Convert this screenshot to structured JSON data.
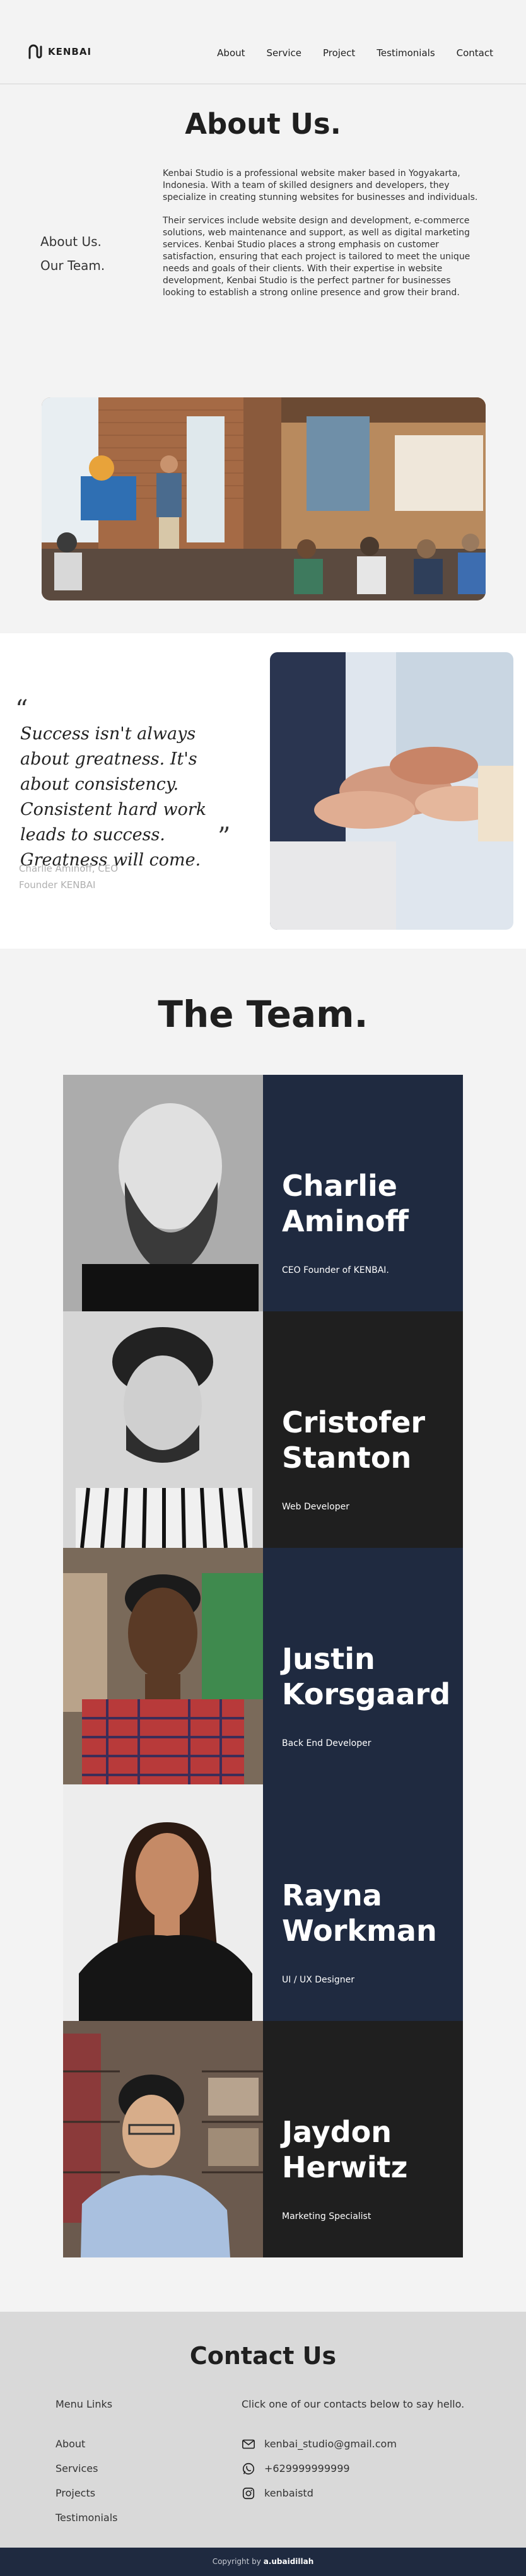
{
  "header": {
    "logo_text": "KENBAI",
    "nav": [
      "About",
      "Service",
      "Project",
      "Testimonials",
      "Contact"
    ]
  },
  "about": {
    "title": "About Us.",
    "side_links": [
      "About Us.",
      "Our Team."
    ],
    "paragraph_1": "Kenbai Studio is a professional website maker based in Yogyakarta, Indonesia. With a team of skilled designers and developers, they specialize in creating stunning websites for businesses and individuals.",
    "paragraph_2": "Their services include website design and development, e-commerce solutions, web maintenance and support, as well as digital marketing services. Kenbai Studio places a strong emphasis on customer satisfaction, ensuring that each project is tailored to meet the unique needs and goals of their clients. With their expertise in website development, Kenbai Studio is the perfect partner for businesses looking to establish a strong online presence and grow their brand."
  },
  "quote": {
    "open_mark": "“",
    "text": "Success isn't always about greatness. It's about consistency. Consistent hard work leads to success. Greatness will come.",
    "close_mark": "”",
    "author_line_1": "Charlie Aminoff, CEO",
    "author_line_2": "Founder KENBAI"
  },
  "team": {
    "title": "The Team.",
    "members": [
      {
        "name": "Charlie Aminoff",
        "role": "CEO Founder of KENBAI."
      },
      {
        "name": "Cristofer Stanton",
        "role": "Web Developer"
      },
      {
        "name": "Justin Korsgaard",
        "role": "Back End Developer"
      },
      {
        "name": "Rayna Workman",
        "role": "UI / UX Designer"
      },
      {
        "name": "Jaydon Herwitz",
        "role": "Marketing Specialist"
      }
    ]
  },
  "contact": {
    "title": "Contact Us",
    "menu_heading": "Menu Links",
    "menu_links": [
      "About",
      "Services",
      "Projects",
      "Testimonials"
    ],
    "contact_heading": "Click one of our contacts below to say hello.",
    "email": "kenbai_studio@gmail.com",
    "phone": "+629999999999",
    "instagram": "kenbaistd"
  },
  "footer": {
    "prefix": "Copyright by",
    "author": "a.ubaidillah"
  },
  "colors": {
    "navy": "#1f2a40",
    "dark": "#1f1f1f",
    "page_bg": "#f3f3f3",
    "contact_bg": "#d9d9d9"
  }
}
